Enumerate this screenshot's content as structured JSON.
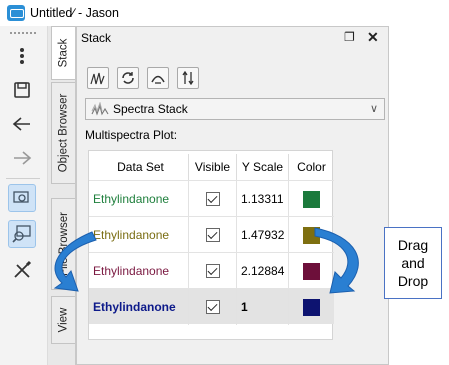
{
  "window": {
    "title": "Untitled∕ - Jason"
  },
  "panel": {
    "title": "Stack",
    "float_label": "❐",
    "close_label": "✕"
  },
  "vtabs": [
    {
      "label": "Stack"
    },
    {
      "label": "Object Browser"
    },
    {
      "label": "File Browser"
    },
    {
      "label": "View"
    }
  ],
  "mode": {
    "label": "Spectra Stack"
  },
  "plot_label": "Multispectra Plot:",
  "table": {
    "headers": [
      "Data Set",
      "Visible",
      "Y Scale",
      "Color"
    ],
    "rows": [
      {
        "name": "Ethylindanone",
        "scale": "1.13311",
        "visible": true,
        "text_color": "#1e7f3c",
        "swatch": "#1b7a3c"
      },
      {
        "name": "Ethylindanone",
        "scale": "1.47932",
        "visible": true,
        "text_color": "#7a6d12",
        "swatch": "#7e6f10"
      },
      {
        "name": "Ethylindanone",
        "scale": "2.12884",
        "visible": true,
        "text_color": "#7a1840",
        "swatch": "#6d0f3a"
      },
      {
        "name": "Ethylindanone",
        "scale": "1",
        "visible": true,
        "text_color": "#0d1a8a",
        "swatch": "#0d1370"
      }
    ]
  },
  "callout": {
    "line1": "Drag",
    "line2": "and",
    "line3": "Drop"
  },
  "colors": {
    "arrow": "#2a7fd2",
    "arrow_edge": "#1b5fae"
  }
}
